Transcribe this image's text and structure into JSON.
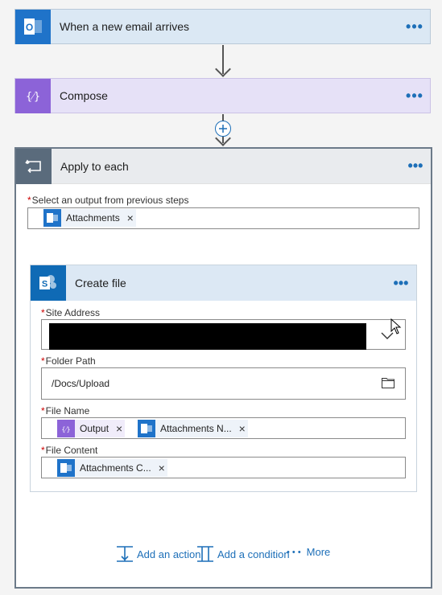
{
  "trigger": {
    "title": "When a new email arrives",
    "more": "•••"
  },
  "compose": {
    "title": "Compose",
    "more": "•••"
  },
  "loop": {
    "title": "Apply to each",
    "more": "•••",
    "select_label": "Select an output from previous steps",
    "select_token": "Attachments",
    "token_close": "×"
  },
  "create_file": {
    "title": "Create file",
    "more": "•••",
    "site_address_label": "Site Address",
    "folder_path_label": "Folder Path",
    "folder_path_value": "/Docs/Upload",
    "file_name_label": "File Name",
    "file_name_token_1": "Output",
    "file_name_token_2": "Attachments N...",
    "file_content_label": "File Content",
    "file_content_token": "Attachments C...",
    "token_close": "×",
    "required_mark": "*"
  },
  "footer": {
    "add_action": "Add an action",
    "add_condition": "Add a condition",
    "more_dots": "• • •",
    "more": "More"
  },
  "colors": {
    "accent": "#1d6fb8",
    "outlook": "#1f73c9",
    "compose": "#8c63d8",
    "sharepoint": "#0f6ab5"
  },
  "icons": [
    "outlook-icon",
    "compose-icon",
    "loop-icon",
    "sharepoint-icon",
    "chevron-down-icon",
    "folder-icon",
    "add-action-icon",
    "add-condition-icon",
    "plus-circle-icon"
  ]
}
